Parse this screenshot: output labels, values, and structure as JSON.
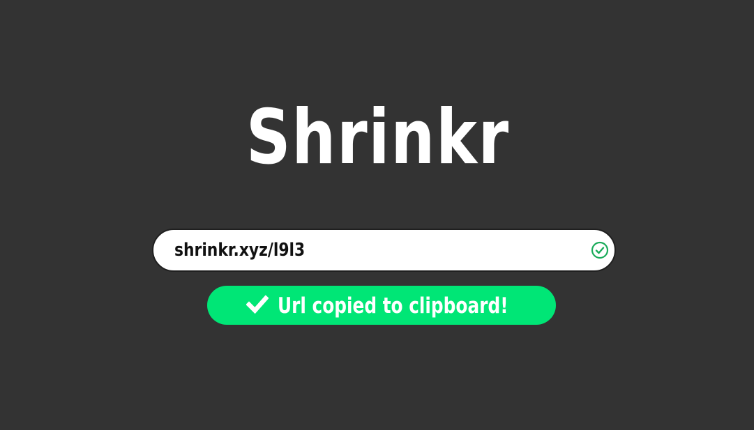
{
  "app": {
    "title": "Shrinkr"
  },
  "url_field": {
    "value": "shrinkr.xyz/l9l3",
    "copy_icon": "check-circle-icon"
  },
  "toast": {
    "icon": "check-icon",
    "message": "Url copied to clipboard!"
  },
  "colors": {
    "background": "#333333",
    "accent": "#00e676",
    "field_background": "#ffffff"
  }
}
